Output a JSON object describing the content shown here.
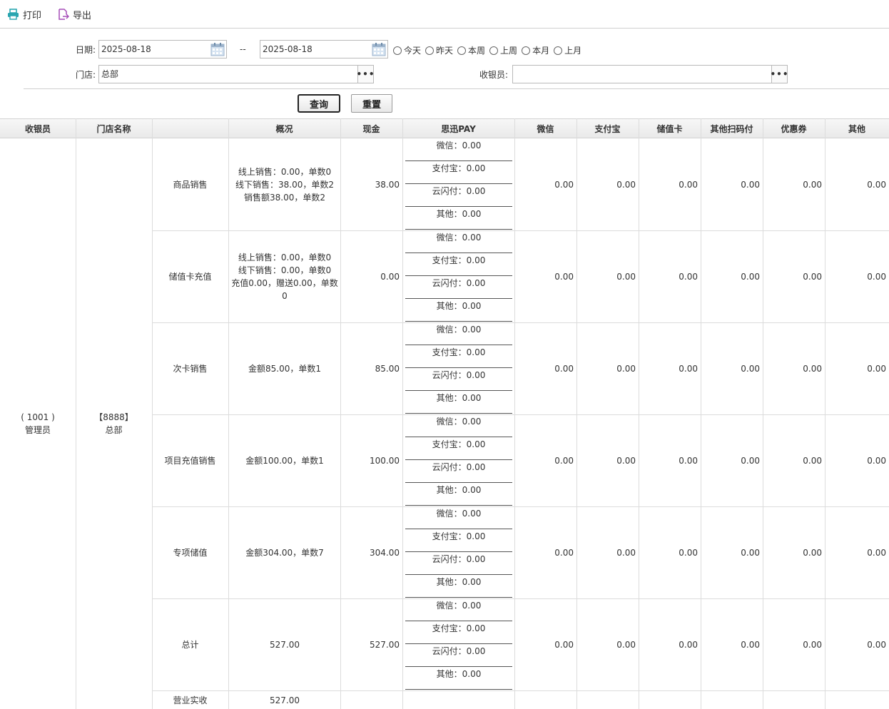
{
  "toolbar": {
    "print": "打印",
    "export": "导出"
  },
  "filter": {
    "date_label": "日期:",
    "date_from": "2025-08-18",
    "date_sep": "--",
    "date_to": "2025-08-18",
    "quick": [
      "今天",
      "昨天",
      "本周",
      "上周",
      "本月",
      "上月"
    ],
    "store_label": "门店:",
    "store_value": "总部",
    "cashier_label": "收银员:",
    "cashier_value": "",
    "more": "•••",
    "query": "查询",
    "reset": "重置"
  },
  "columns": [
    "收银员",
    "门店名称",
    "",
    "概况",
    "现金",
    "思迅PAY",
    "微信",
    "支付宝",
    "储值卡",
    "其他扫码付",
    "优惠券",
    "其他"
  ],
  "cashier": {
    "code": "( 1001 )",
    "name": "管理员"
  },
  "store": {
    "code": "【8888】",
    "name": "总部"
  },
  "pay_labels": [
    "微信：0.00",
    "支付宝：0.00",
    "云闪付：0.00",
    "其他：0.00"
  ],
  "rows": [
    {
      "category": "商品销售",
      "summary": [
        "线上销售：0.00，单数0",
        "线下销售：38.00，单数2",
        "销售额38.00，单数2"
      ],
      "cash": "38.00",
      "rest": [
        "0.00",
        "0.00",
        "0.00",
        "0.00",
        "0.00",
        "0.00"
      ]
    },
    {
      "category": "储值卡充值",
      "summary": [
        "线上销售：0.00，单数0",
        "线下销售：0.00，单数0",
        "充值0.00，赠送0.00，单数",
        "0"
      ],
      "cash": "0.00",
      "rest": [
        "0.00",
        "0.00",
        "0.00",
        "0.00",
        "0.00",
        "0.00"
      ]
    },
    {
      "category": "次卡销售",
      "summary": [
        "金额85.00，单数1"
      ],
      "cash": "85.00",
      "rest": [
        "0.00",
        "0.00",
        "0.00",
        "0.00",
        "0.00",
        "0.00"
      ]
    },
    {
      "category": "项目充值销售",
      "summary": [
        "金额100.00，单数1"
      ],
      "cash": "100.00",
      "rest": [
        "0.00",
        "0.00",
        "0.00",
        "0.00",
        "0.00",
        "0.00"
      ]
    },
    {
      "category": "专项储值",
      "summary": [
        "金额304.00，单数7"
      ],
      "cash": "304.00",
      "rest": [
        "0.00",
        "0.00",
        "0.00",
        "0.00",
        "0.00",
        "0.00"
      ]
    },
    {
      "category": "总计",
      "summary": [
        "527.00"
      ],
      "cash": "527.00",
      "rest": [
        "0.00",
        "0.00",
        "0.00",
        "0.00",
        "0.00",
        "0.00"
      ]
    }
  ],
  "footer": {
    "label": "营业实收",
    "value": "527.00"
  }
}
